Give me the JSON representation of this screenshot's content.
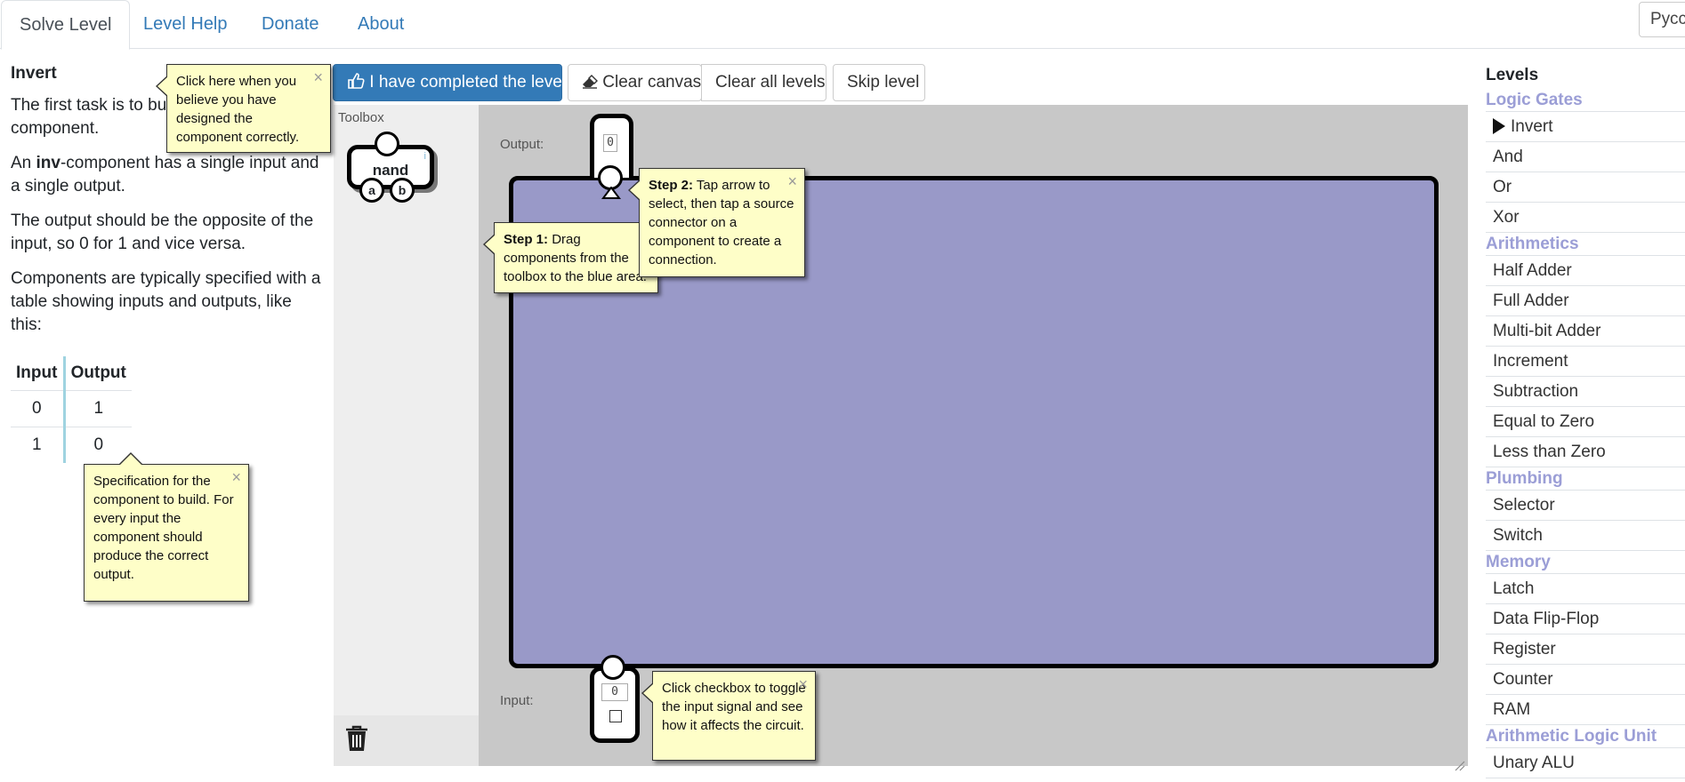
{
  "nav": {
    "tabs": [
      "Solve Level",
      "Level Help",
      "Donate",
      "About"
    ],
    "language": "Русский"
  },
  "description": {
    "title": "Invert",
    "p1": "The first task is to build an inv-component.",
    "p1_visible_a": "The first task is to bui",
    "p1_visible_b": "component.",
    "p2_prefix": "An ",
    "p2_bold": "inv",
    "p2_suffix": "-component has a single input and a single output.",
    "p3": "The output should be the opposite of the input, so 0 for 1 and vice versa.",
    "p4": "Components are typically specified with a table showing inputs and outputs, like this:",
    "table": {
      "headers": [
        "Input",
        "Output"
      ],
      "rows": [
        [
          "0",
          "1"
        ],
        [
          "1",
          "0"
        ]
      ]
    }
  },
  "tips": {
    "complete": "Click here when you believe you have designed the component correctly.",
    "spec": "Specification for the component to build. For every input the component should produce the correct output.",
    "step1_title": "Step 1:",
    "step1": "Drag components from the toolbox to the blue area.",
    "step2_title": "Step 2:",
    "step2": "Tap arrow to select, then tap a source connector on a component to create a connection.",
    "checkbox": "Click checkbox to toggle the input signal and see how it affects the circuit.",
    "close": "×"
  },
  "toolbar": {
    "complete": "I have completed the level",
    "clear_canvas": "Clear canvas",
    "clear_all": "Clear all levels",
    "skip": "Skip level"
  },
  "toolbox": {
    "label": "Toolbox",
    "gate": "nand",
    "pin_a": "a",
    "pin_b": "b"
  },
  "canvas": {
    "output_label": "Output:",
    "input_label": "Input:",
    "output_value": "0",
    "input_value": "0"
  },
  "levels": {
    "title": "Levels",
    "groups": [
      {
        "name": "Logic Gates",
        "items": [
          "Invert",
          "And",
          "Or",
          "Xor"
        ]
      },
      {
        "name": "Arithmetics",
        "items": [
          "Half Adder",
          "Full Adder",
          "Multi-bit Adder",
          "Increment",
          "Subtraction",
          "Equal to Zero",
          "Less than Zero"
        ]
      },
      {
        "name": "Plumbing",
        "items": [
          "Selector",
          "Switch"
        ]
      },
      {
        "name": "Memory",
        "items": [
          "Latch",
          "Data Flip-Flop",
          "Register",
          "Counter",
          "RAM"
        ]
      },
      {
        "name": "Arithmetic Logic Unit",
        "items": [
          "Unary ALU"
        ]
      }
    ],
    "current": "Invert"
  }
}
